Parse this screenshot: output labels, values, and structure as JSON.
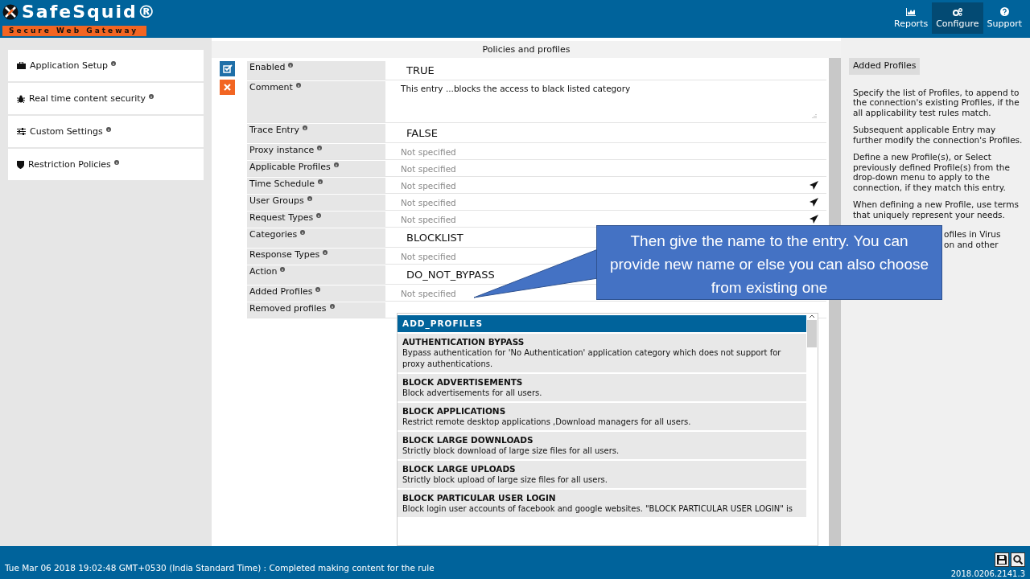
{
  "header": {
    "logo_title": "SafeSquid®",
    "logo_subtitle": "Secure Web Gateway",
    "nav": [
      {
        "label": "Reports",
        "selected": false
      },
      {
        "label": "Configure",
        "selected": true
      },
      {
        "label": "Support",
        "selected": false
      }
    ]
  },
  "sidebar": {
    "items": [
      {
        "label": "Application Setup"
      },
      {
        "label": "Real time content security"
      },
      {
        "label": "Custom Settings"
      },
      {
        "label": "Restriction Policies"
      }
    ]
  },
  "main": {
    "title": "Policies and profiles",
    "enabled": true,
    "fields": [
      {
        "label": "Enabled",
        "kind": "large",
        "value": "TRUE"
      },
      {
        "label": "Comment",
        "kind": "textarea",
        "value": "This entry ...blocks the access to black listed category"
      },
      {
        "label": "Trace Entry",
        "kind": "large",
        "value": "FALSE"
      },
      {
        "label": "Proxy instance",
        "kind": "empty",
        "placeholder": "Not specified"
      },
      {
        "label": "Applicable Profiles",
        "kind": "empty",
        "placeholder": "Not specified"
      },
      {
        "label": "Time Schedule",
        "kind": "picker",
        "placeholder": "Not specified"
      },
      {
        "label": "User Groups",
        "kind": "picker",
        "placeholder": "Not specified"
      },
      {
        "label": "Request Types",
        "kind": "picker",
        "placeholder": "Not specified"
      },
      {
        "label": "Categories",
        "kind": "large",
        "value": "BLOCKLIST"
      },
      {
        "label": "Response Types",
        "kind": "empty",
        "placeholder": "Not specified"
      },
      {
        "label": "Action",
        "kind": "large",
        "value": "DO_NOT_BYPASS"
      },
      {
        "label": "Added Profiles",
        "kind": "empty",
        "placeholder": "Not specified"
      },
      {
        "label": "Removed profiles",
        "kind": "blank"
      }
    ],
    "dropdown": {
      "title": "ADD_PROFILES",
      "options": [
        {
          "name": "AUTHENTICATION BYPASS",
          "description": "Bypass authentication for 'No Authentication' application category which does not support for proxy authentications."
        },
        {
          "name": "BLOCK ADVERTISEMENTS",
          "description": "Block advertisements for all users."
        },
        {
          "name": "BLOCK APPLICATIONS",
          "description": "Restrict remote desktop applications ,Download managers for all users."
        },
        {
          "name": "BLOCK LARGE DOWNLOADS",
          "description": "Strictly block download of large size files for all users."
        },
        {
          "name": "BLOCK LARGE UPLOADS",
          "description": "Strictly block upload of large size files for all users."
        },
        {
          "name": "BLOCK PARTICULAR USER LOGIN",
          "description": "Block login user accounts of facebook and google websites. \"BLOCK PARTICULAR USER LOGIN\" is"
        }
      ]
    }
  },
  "help": {
    "title": "Added Profiles",
    "paragraphs": [
      "Specify the list of Profiles, to append to the connection's existing Profiles, if the all applicability test rules match.",
      "Subsequent applicable Entry may further modify the connection's Profiles.",
      "Define a new Profile(s), or Select previously defined Profile(s) from the drop-down menu to apply to the connection, if they match this entry.",
      "When defining a new Profile, use terms that uniquely represent your needs."
    ],
    "covered_lines": [
      "ofiles in Virus",
      "on and other"
    ]
  },
  "callout": {
    "text": "Then give the name to the entry. You can provide new name or else you can also choose from existing one"
  },
  "footer": {
    "status": "Tue Mar 06 2018 19:02:48 GMT+0530 (India Standard Time) : Completed making content for the rule",
    "version": "2018.0206.2141.3"
  }
}
